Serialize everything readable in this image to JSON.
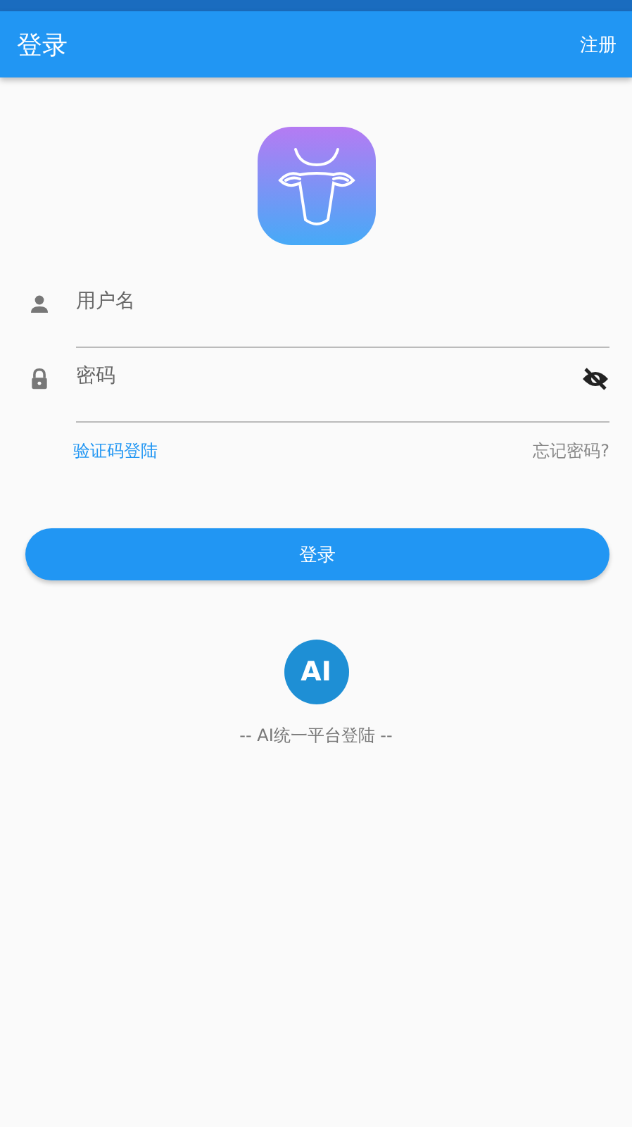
{
  "app_bar": {
    "title": "登录",
    "action": "注册"
  },
  "fields": [
    {
      "kind": "text",
      "placeholder": "用户名"
    },
    {
      "kind": "password",
      "placeholder": "密码",
      "visible": false
    }
  ],
  "links": {
    "sms_login": "验证码登陆",
    "forgot": "忘记密码?"
  },
  "login_button": "登录",
  "ai_login": {
    "badge": "AI",
    "caption": "-- AI统一平台登陆 --"
  }
}
